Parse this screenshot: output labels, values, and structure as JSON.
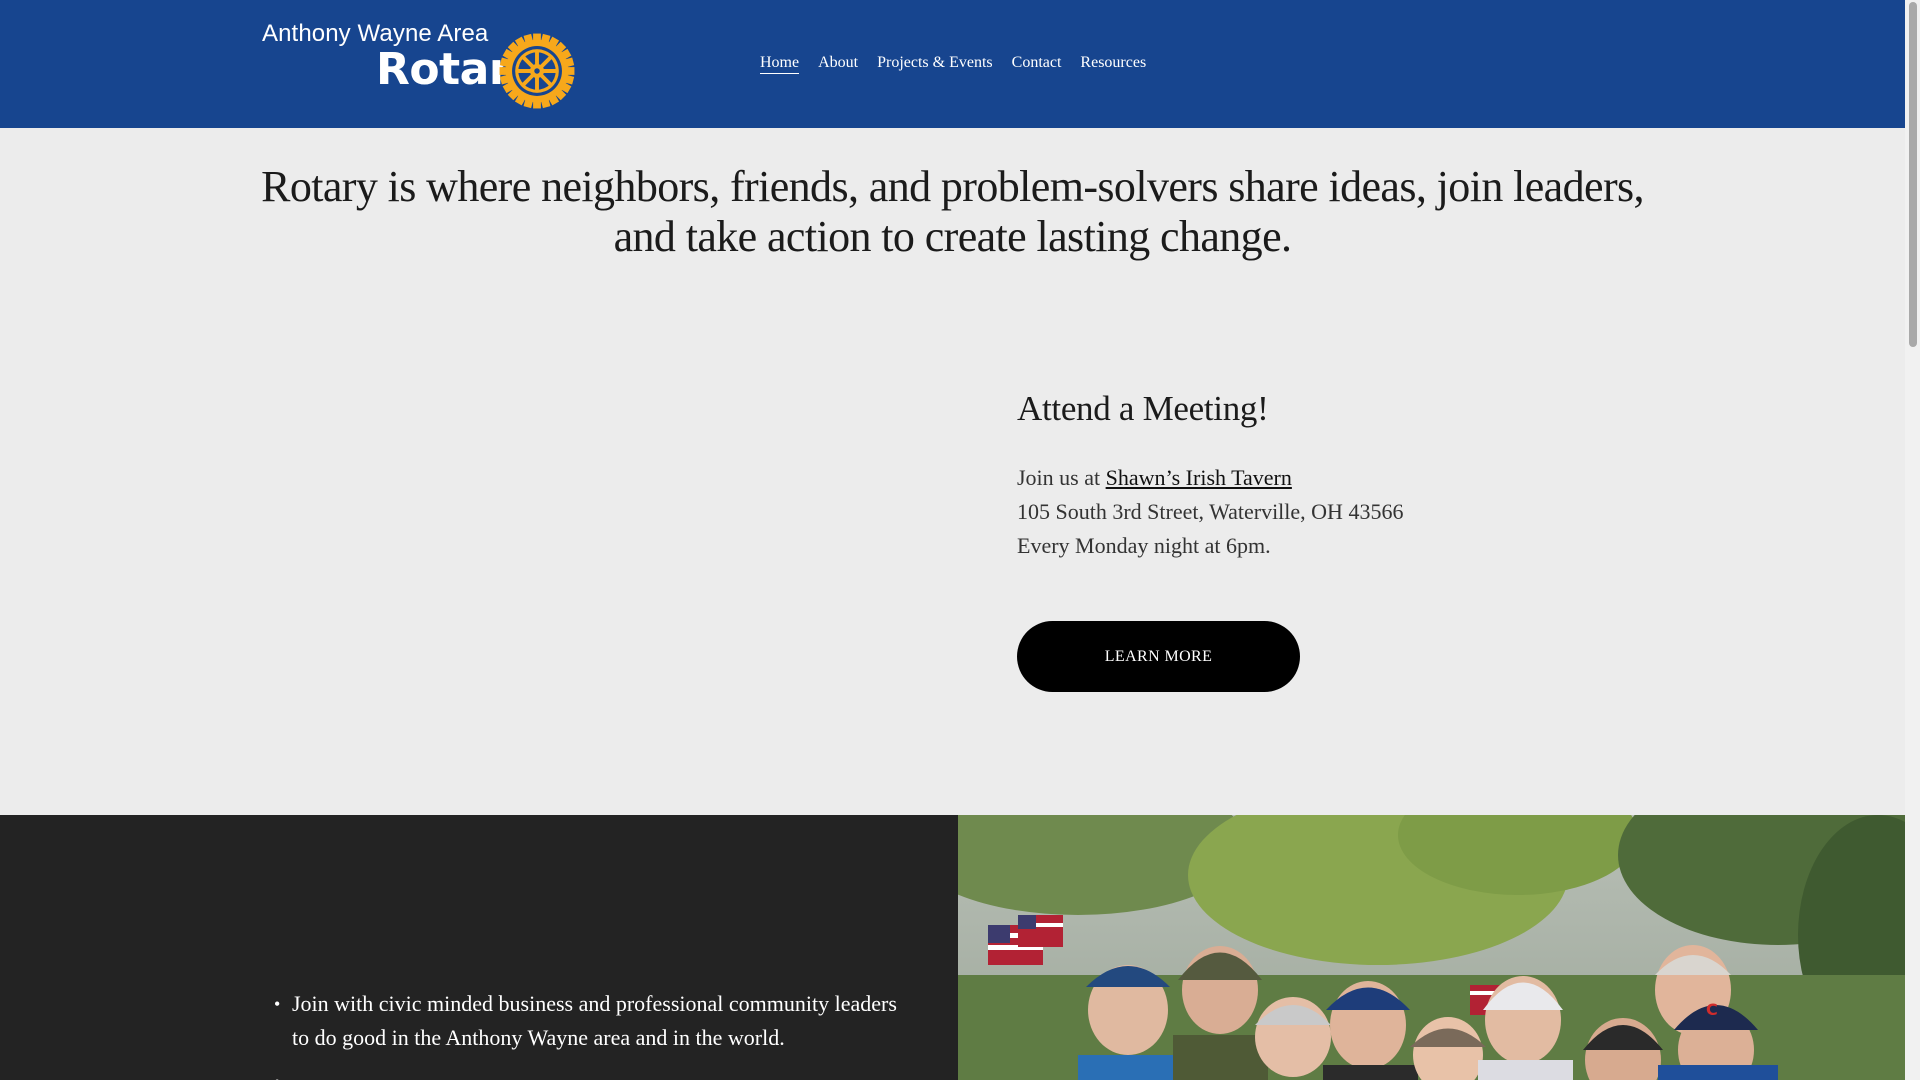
{
  "header": {
    "logo": {
      "line1": "Anthony Wayne Area",
      "line2": "Rotary",
      "emblem_icon": "rotary-wheel-icon",
      "emblem_color": "#f7a81b"
    },
    "nav": [
      {
        "label": "Home",
        "active": true
      },
      {
        "label": "About"
      },
      {
        "label": "Projects & Events"
      },
      {
        "label": "Contact"
      },
      {
        "label": "Resources"
      }
    ],
    "background": "#17458f"
  },
  "hero": {
    "tagline": "Rotary is where neighbors, friends, and problem-solvers share ideas, join leaders, and take action to create lasting change."
  },
  "meeting": {
    "heading": "Attend a Meeting!",
    "join_prefix": "Join us at ",
    "venue_link": "Shawn’s Irish Tavern",
    "address": "105 South 3rd Street, Waterville, OH 43566",
    "schedule": "Every Monday night at 6pm.",
    "button_label": "LEARN MORE"
  },
  "benefits": {
    "items": [
      "Join with civic minded business and professional community leaders to do good in the Anthony Wayne area and in the world.",
      ""
    ]
  },
  "photo": {
    "icon": "group-photo-icon"
  }
}
